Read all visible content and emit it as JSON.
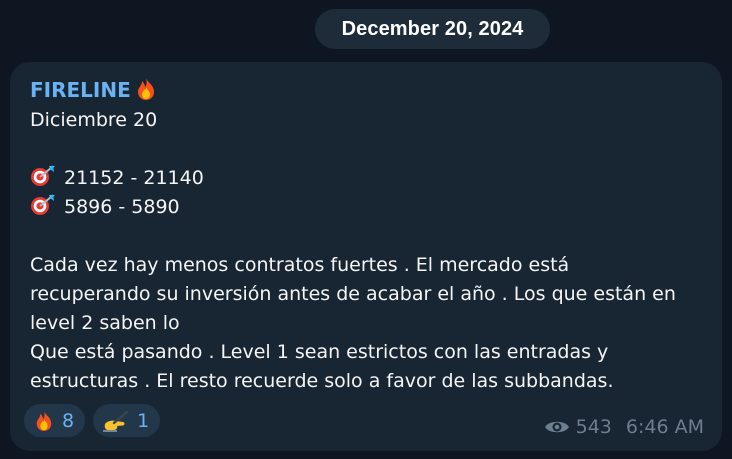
{
  "date_separator": "December 20, 2024",
  "message": {
    "channel_name": "FIRELINE",
    "channel_icon": "fire-icon",
    "lines": {
      "date": "Diciembre 20",
      "target1": "21152 - 21140",
      "target2": "5896 - 5890",
      "p1": "Cada vez hay menos contratos fuertes . El mercado está",
      "p2": "recuperando su inversión antes de acabar el año . Los que están en",
      "p3": "level 2 saben lo",
      "p4": "Que está pasando . Level 1 sean estrictos con las entradas y",
      "p5": "estructuras . El resto recuerde solo a favor de las subbandas."
    },
    "target_icon": "dart-target-icon"
  },
  "reactions": [
    {
      "icon": "fire-icon",
      "count": "8"
    },
    {
      "icon": "writing-hand-icon",
      "count": "1"
    }
  ],
  "meta": {
    "views_icon": "eye-icon",
    "views": "543",
    "time": "6:46 AM"
  },
  "colors": {
    "background": "#0e1621",
    "bubble": "#182533",
    "accent": "#6ab3f3",
    "text": "#f5f5f5",
    "muted": "#6d7f8f"
  }
}
